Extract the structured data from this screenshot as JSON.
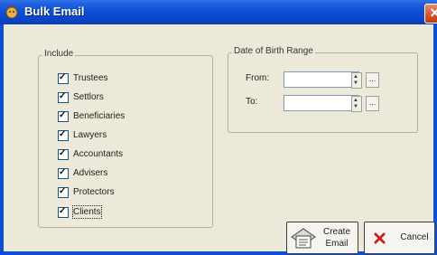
{
  "window": {
    "title": "Bulk Email"
  },
  "include_group": {
    "legend": "Include",
    "options": [
      {
        "label": "Trustees",
        "checked": true
      },
      {
        "label": "Settlors",
        "checked": true
      },
      {
        "label": "Beneficiaries",
        "checked": true
      },
      {
        "label": "Lawyers",
        "checked": true
      },
      {
        "label": "Accountants",
        "checked": true
      },
      {
        "label": "Advisers",
        "checked": true
      },
      {
        "label": "Protectors",
        "checked": true
      },
      {
        "label": "Clients",
        "checked": true
      }
    ]
  },
  "dob_group": {
    "legend": "Date of Birth Range",
    "from_label": "From:",
    "to_label": "To:",
    "from_value": "",
    "to_value": "",
    "browse_label": "..."
  },
  "buttons": {
    "create_line1": "Create",
    "create_line2": "Email",
    "cancel": "Cancel"
  },
  "colors": {
    "titlebar": "#0b4fd6",
    "dialog_bg": "#ECE9D8",
    "close_button": "#d4522a",
    "cancel_icon": "#cc1f1f"
  },
  "icons": [
    "app-icon",
    "close-icon",
    "checkmark-icon",
    "spin-up-icon",
    "spin-down-icon",
    "email-icon",
    "cancel-x-icon"
  ]
}
